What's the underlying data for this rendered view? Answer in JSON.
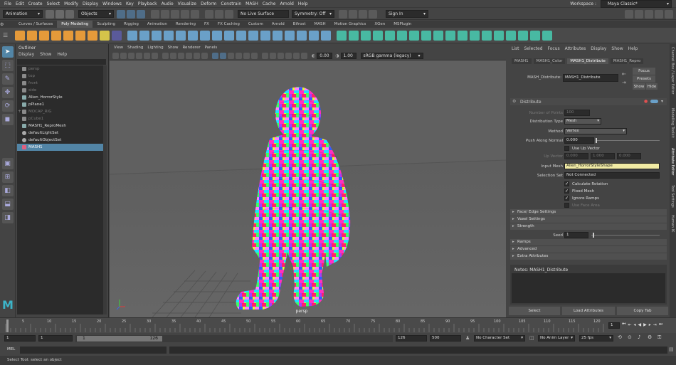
{
  "menubar": {
    "items": [
      "File",
      "Edit",
      "Create",
      "Select",
      "Modify",
      "Display",
      "Windows",
      "Key",
      "Playback",
      "Audio",
      "Visualize",
      "Deform",
      "Constrain",
      "MASH",
      "Cache",
      "Arnold",
      "Help"
    ],
    "workspace_label": "Workspace :",
    "workspace_value": "Maya Classic*"
  },
  "statusline": {
    "mode": "Animation",
    "objects": "Objects",
    "live_surface": "No Live Surface",
    "symmetry": "Symmetry: Off",
    "sign_in": "Sign In"
  },
  "shelf_tabs": [
    "Curves / Surfaces",
    "Poly Modeling",
    "Sculpting",
    "Rigging",
    "Animation",
    "Rendering",
    "FX",
    "FX Caching",
    "Custom",
    "Arnold",
    "Bifrost",
    "MASH",
    "Motion Graphics",
    "XGen",
    "MSPlugin"
  ],
  "shelf_active": "Poly Modeling",
  "outliner": {
    "title": "Outliner",
    "menu": [
      "Display",
      "Show",
      "Help"
    ],
    "items": [
      {
        "label": "persp",
        "dim": true
      },
      {
        "label": "top",
        "dim": true
      },
      {
        "label": "front",
        "dim": true
      },
      {
        "label": "side",
        "dim": true
      },
      {
        "label": "Alien_HorrorStyle",
        "dim": false
      },
      {
        "label": "pPlane1",
        "dim": false
      },
      {
        "label": "MOCAP_RIG",
        "dim": true
      },
      {
        "label": "pCube1",
        "dim": true
      },
      {
        "label": "MASH1_ReproMesh",
        "dim": false
      },
      {
        "label": "defaultLightSet",
        "dim": false
      },
      {
        "label": "defaultObjectSet",
        "dim": false
      },
      {
        "label": "MASH1",
        "dim": false,
        "selected": true
      }
    ]
  },
  "viewport": {
    "menu": [
      "View",
      "Shading",
      "Lighting",
      "Show",
      "Renderer",
      "Panels"
    ],
    "exposure": "0.00",
    "gamma": "1.00",
    "colorspace": "sRGB gamma (legacy)",
    "camera_label": "persp"
  },
  "attribute_editor": {
    "menu": [
      "List",
      "Selected",
      "Focus",
      "Attributes",
      "Display",
      "Show",
      "Help"
    ],
    "tabs": [
      "MASH1",
      "MASH1_Color",
      "MASH1_Distribute",
      "MASH1_Repro"
    ],
    "active_tab": "MASH1_Distribute",
    "node_label": "MASH_Distribute:",
    "node_value": "MASH1_Distribute",
    "focus_btn": "Focus",
    "presets_btn": "Presets",
    "show_btn": "Show",
    "hide_btn": "Hide",
    "section_title": "Distribute",
    "fields": {
      "number_of_points_label": "Number of Points",
      "number_of_points": "100",
      "distribution_type_label": "Distribution Type",
      "distribution_type": "Mesh",
      "method_label": "Method",
      "method": "Vertex",
      "push_label": "Push Along Normal",
      "push": "0.000",
      "use_up_vector": "Use Up Vector",
      "up_vector_label": "Up Vector",
      "up_vector": [
        "0.000",
        "1.000",
        "0.000"
      ],
      "input_mesh_label": "Input Mesh",
      "input_mesh": "Alien_HorrorStyleShape",
      "selection_set_label": "Selection Set",
      "selection_set": "Not Connected",
      "calculate_rotation": "Calculate Rotation",
      "flood_mesh": "Flood Mesh",
      "ignore_ramps": "Ignore Ramps",
      "use_face_area": "Use Face Area"
    },
    "sections": [
      "Face/ Edge Settings",
      "Voxel Settings",
      "Strength"
    ],
    "seed_label": "Seed",
    "seed": "1",
    "sections2": [
      "Ramps",
      "Advanced",
      "Extra Attributes"
    ],
    "notes": "Notes:  MASH1_Distribute",
    "buttons": [
      "Select",
      "Load Attributes",
      "Copy Tab"
    ]
  },
  "side_tabs": [
    "Channel Box / Layer Editor",
    "Modelling Toolkit",
    "Attribute Editor",
    "Tool Settings",
    "Human IK"
  ],
  "timeline": {
    "ticks": [
      "5",
      "10",
      "15",
      "20",
      "25",
      "30",
      "35",
      "40",
      "45",
      "50",
      "55",
      "60",
      "65",
      "70",
      "75",
      "80",
      "85",
      "90",
      "95",
      "100",
      "105",
      "110",
      "115",
      "120"
    ],
    "current": "1"
  },
  "range": {
    "start": "1",
    "start2": "1",
    "slider_start": "1",
    "slider_end": "126",
    "end": "126",
    "end2": "500",
    "character_set": "No Character Set",
    "anim_layer": "No Anim Layer",
    "fps": "25 fps"
  },
  "cmdline": {
    "label": "MEL"
  },
  "helpline": {
    "text": "Select Tool: select an object"
  }
}
